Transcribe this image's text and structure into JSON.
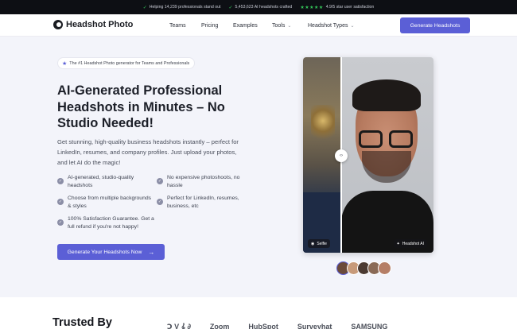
{
  "topbar": {
    "stat1": "Helping 14,239 professionals stand out",
    "stat2": "5,453,623 AI headshots crafted",
    "rating": "4.9/5 star user satisfaction",
    "stars": "★★★★★"
  },
  "brand": {
    "name": "Headshot Photo"
  },
  "nav": {
    "items": [
      "Teams",
      "Pricing",
      "Examples",
      "Tools",
      "Headshot Types"
    ],
    "cta": "Generate Headshots"
  },
  "hero": {
    "badge": "The #1 Headshot Photo generator for Teams and Professionals",
    "title": "AI-Generated Professional Headshots in Minutes – No Studio Needed!",
    "lead": "Get stunning, high-quality business headshots instantly – perfect for LinkedIn, resumes, and company profiles. Just upload your photos, and let AI do the magic!",
    "features": [
      "AI-generated, studio-quality headshots",
      "No expensive photoshoots, no hassle",
      "Choose from multiple backgrounds & styles",
      "Perfect for LinkedIn, resumes, business, etc",
      "100% Satisfaction Guarantee. Get a full refund if you're not happy!"
    ],
    "cta": "Generate Your Headshots Now"
  },
  "compare": {
    "before_label": "Selfie",
    "after_label": "Headshot AI"
  },
  "avatars": [
    {
      "color": "#6b4a3a"
    },
    {
      "color": "#c79a7a"
    },
    {
      "color": "#4b3a32"
    },
    {
      "color": "#8a6a56"
    },
    {
      "color": "#b57e66"
    }
  ],
  "trusted": {
    "heading": "Trusted By",
    "logos": [
      "Ↄ V 𝄞 ∂",
      "Zoom",
      "HubSpot",
      "Surveyhat",
      "SAMSUNG"
    ]
  },
  "colors": {
    "accent": "#5b5fd6",
    "topbar_bg": "#0d0f14",
    "check": "#34c759"
  }
}
